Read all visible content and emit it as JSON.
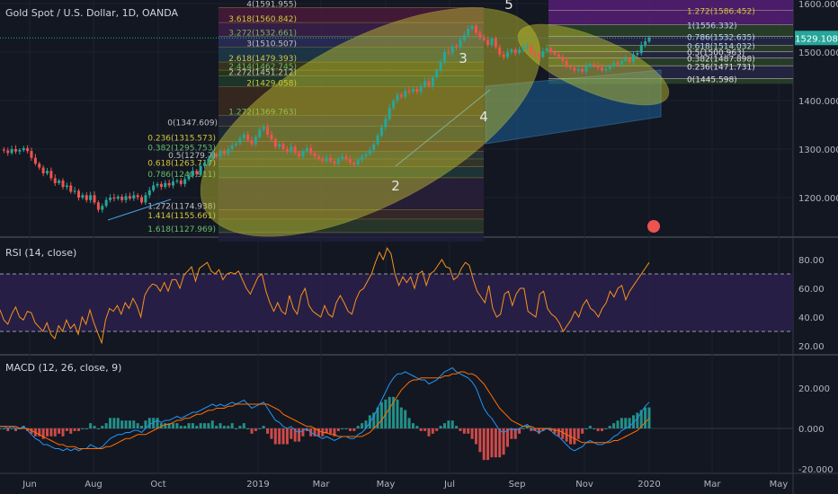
{
  "title": "Gold Spot / U.S. Dollar, 1D, OANDA",
  "price_badge": "1529.108",
  "colors": {
    "background": "#131722",
    "grid": "#363a45",
    "text": "#b2b5be",
    "price_line": "#26a69a",
    "candle_up": "#26a69a",
    "candle_down": "#ef5350",
    "rsi_line": "#f7931a",
    "rsi_band": "#2a1f4a",
    "macd_line": "#2196f3",
    "signal_line": "#ff6d00",
    "hist_up": "#26a69a",
    "hist_down": "#ef5350",
    "ellipse": "#c8c830",
    "channel": "#1e6fb3"
  },
  "chart_data": [
    {
      "type": "candlestick",
      "title": "Gold Spot / U.S. Dollar, 1D, OANDA",
      "ylim": [
        1120,
        1615
      ],
      "y_ticks": [
        "1600.000",
        "1500.000",
        "1400.000",
        "1300.000",
        "1200.000"
      ],
      "x_ticks": [
        "Jun",
        "Aug",
        "Oct",
        "2019",
        "Mar",
        "May",
        "Jul",
        "Sep",
        "Nov",
        "2020",
        "Mar",
        "May"
      ],
      "close_path": [
        1299,
        1297,
        1292,
        1300,
        1295,
        1298,
        1302,
        1296,
        1282,
        1270,
        1262,
        1250,
        1255,
        1240,
        1230,
        1235,
        1222,
        1225,
        1212,
        1214,
        1200,
        1205,
        1195,
        1205,
        1190,
        1175,
        1183,
        1195,
        1200,
        1198,
        1202,
        1195,
        1203,
        1198,
        1205,
        1201,
        1190,
        1205,
        1215,
        1225,
        1228,
        1222,
        1230,
        1225,
        1233,
        1235,
        1228,
        1238,
        1245,
        1255,
        1248,
        1265,
        1272,
        1280,
        1290,
        1285,
        1295,
        1290,
        1300,
        1308,
        1312,
        1322,
        1330,
        1318,
        1310,
        1325,
        1340,
        1346,
        1330,
        1320,
        1305,
        1310,
        1300,
        1295,
        1305,
        1292,
        1285,
        1295,
        1302,
        1292,
        1285,
        1280,
        1275,
        1282,
        1275,
        1270,
        1280,
        1285,
        1280,
        1272,
        1268,
        1278,
        1285,
        1290,
        1298,
        1310,
        1328,
        1345,
        1362,
        1385,
        1400,
        1412,
        1408,
        1420,
        1418,
        1424,
        1418,
        1430,
        1440,
        1430,
        1448,
        1462,
        1480,
        1500,
        1498,
        1512,
        1510,
        1525,
        1535,
        1548,
        1554,
        1540,
        1530,
        1525,
        1515,
        1528,
        1510,
        1495,
        1490,
        1500,
        1505,
        1498,
        1505,
        1510,
        1512,
        1498,
        1495,
        1490,
        1502,
        1508,
        1500,
        1495,
        1490,
        1482,
        1470,
        1468,
        1462,
        1465,
        1460,
        1470,
        1475,
        1472,
        1468,
        1462,
        1465,
        1470,
        1478,
        1475,
        1482,
        1486,
        1480,
        1495,
        1498,
        1515,
        1522,
        1530
      ],
      "fibonacci_levels": [
        {
          "label": "4(1591.955)",
          "value": 1591.955
        },
        {
          "label": "3.618(1560.842)",
          "value": 1560.842
        },
        {
          "label": "3.272(1532.661)",
          "value": 1532.661
        },
        {
          "label": "3(1510.507)",
          "value": 1510.507
        },
        {
          "label": "2.618(1479.393)",
          "value": 1479.393
        },
        {
          "label": "2.414(1462.745)",
          "value": 1462.745
        },
        {
          "label": "2.272(1451.212)",
          "value": 1451.212
        },
        {
          "label": "2(1429.058)",
          "value": 1429.058
        },
        {
          "label": "1.272(1369.763)",
          "value": 1369.763
        },
        {
          "label": "0(1347.609)",
          "value": 1347.609
        },
        {
          "label": "0.236(1315.573)",
          "value": 1315.573
        },
        {
          "label": "0.382(1295.753)",
          "value": 1295.753
        },
        {
          "label": "0.5(1279.7)",
          "value": 1279.7
        },
        {
          "label": "0.618(1263.717)",
          "value": 1263.717
        },
        {
          "label": "0.786(1240.911)",
          "value": 1240.911
        },
        {
          "label": "1.272(1174.938)",
          "value": 1174.938
        },
        {
          "label": "1.414(1155.661)",
          "value": 1155.661
        },
        {
          "label": "1.618(1127.969)",
          "value": 1127.969
        }
      ],
      "fibonacci_right": [
        {
          "label": "1.272(1586.452)",
          "value": 1586.452
        },
        {
          "label": "1(1556.332)",
          "value": 1556.332
        },
        {
          "label": "0.786(1532.635)",
          "value": 1532.635
        },
        {
          "label": "0.618(1514.032)",
          "value": 1514.032
        },
        {
          "label": "0.5(1500.963)",
          "value": 1500.963
        },
        {
          "label": "0.382(1487.898)",
          "value": 1487.898
        },
        {
          "label": "0.236(1471.731)",
          "value": 1471.731
        },
        {
          "label": "0(1445.598)",
          "value": 1445.598
        }
      ],
      "wave_labels": [
        "2",
        "3",
        "4",
        "5"
      ],
      "last_price": 1529.108
    },
    {
      "type": "line",
      "title": "RSI (14, close)",
      "ylim": [
        15,
        92
      ],
      "levels": [
        70,
        30
      ],
      "y_ticks": [
        "80.00",
        "60.00",
        "40.00",
        "20.00"
      ],
      "values": [
        45,
        38,
        35,
        42,
        47,
        40,
        38,
        44,
        43,
        36,
        33,
        30,
        36,
        28,
        25,
        34,
        30,
        38,
        32,
        35,
        28,
        40,
        35,
        45,
        36,
        29,
        22,
        38,
        46,
        44,
        48,
        42,
        50,
        46,
        53,
        48,
        40,
        55,
        60,
        63,
        62,
        58,
        64,
        58,
        66,
        66,
        60,
        69,
        72,
        75,
        65,
        74,
        76,
        78,
        72,
        70,
        73,
        66,
        70,
        71,
        70,
        72,
        66,
        60,
        56,
        62,
        68,
        70,
        58,
        50,
        44,
        50,
        44,
        42,
        55,
        46,
        42,
        55,
        60,
        48,
        44,
        42,
        40,
        48,
        42,
        40,
        50,
        55,
        50,
        44,
        42,
        52,
        58,
        60,
        65,
        70,
        78,
        85,
        80,
        88,
        84,
        70,
        62,
        68,
        64,
        68,
        60,
        70,
        72,
        62,
        70,
        72,
        76,
        80,
        75,
        74,
        66,
        68,
        74,
        78,
        76,
        66,
        58,
        54,
        50,
        62,
        46,
        40,
        42,
        56,
        58,
        48,
        56,
        60,
        60,
        44,
        42,
        40,
        56,
        58,
        46,
        42,
        40,
        36,
        30,
        34,
        38,
        44,
        40,
        48,
        52,
        46,
        44,
        40,
        46,
        50,
        58,
        54,
        60,
        62,
        52,
        58,
        62,
        66,
        70,
        74,
        78
      ]
    },
    {
      "type": "line+bar",
      "title": "MACD (12, 26, close, 9)",
      "ylim": [
        -21,
        35
      ],
      "y_ticks": [
        "20.000",
        "0.000",
        "-20.000"
      ],
      "macd": [
        1,
        1,
        0,
        1,
        0,
        0,
        1,
        -1,
        -3,
        -5,
        -6,
        -8,
        -8,
        -9,
        -10,
        -10,
        -11,
        -10,
        -11,
        -10,
        -11,
        -10,
        -10,
        -8,
        -9,
        -10,
        -9,
        -7,
        -5,
        -4,
        -3,
        -3,
        -2,
        -2,
        -1,
        -1,
        -2,
        0,
        2,
        3,
        4,
        3,
        4,
        4,
        5,
        6,
        5,
        6,
        7,
        8,
        8,
        9,
        10,
        11,
        12,
        11,
        12,
        11,
        12,
        13,
        12,
        13,
        14,
        12,
        10,
        11,
        12,
        13,
        10,
        7,
        4,
        3,
        1,
        0,
        1,
        -1,
        -2,
        -1,
        0,
        -2,
        -3,
        -4,
        -5,
        -4,
        -5,
        -6,
        -5,
        -4,
        -4,
        -5,
        -5,
        -3,
        -2,
        0,
        3,
        6,
        10,
        14,
        18,
        22,
        25,
        27,
        27,
        28,
        27,
        26,
        25,
        24,
        24,
        22,
        23,
        24,
        26,
        28,
        29,
        30,
        28,
        27,
        26,
        25,
        23,
        20,
        15,
        10,
        7,
        5,
        2,
        -1,
        -2,
        -1,
        0,
        -1,
        0,
        1,
        2,
        0,
        -1,
        -2,
        -1,
        0,
        -1,
        -3,
        -4,
        -6,
        -8,
        -10,
        -11,
        -10,
        -9,
        -7,
        -6,
        -7,
        -8,
        -8,
        -7,
        -6,
        -4,
        -3,
        -1,
        0,
        1,
        3,
        5,
        8,
        11,
        13
      ],
      "signal": [
        1,
        1,
        1,
        1,
        1,
        0,
        0,
        0,
        -1,
        -2,
        -3,
        -4,
        -5,
        -6,
        -7,
        -8,
        -8,
        -9,
        -9,
        -9,
        -10,
        -10,
        -10,
        -10,
        -10,
        -10,
        -10,
        -9,
        -9,
        -8,
        -7,
        -6,
        -5,
        -5,
        -4,
        -3,
        -3,
        -3,
        -2,
        -1,
        0,
        1,
        2,
        2,
        3,
        4,
        4,
        5,
        5,
        6,
        7,
        7,
        8,
        9,
        9,
        10,
        10,
        10,
        11,
        11,
        12,
        12,
        12,
        12,
        12,
        12,
        12,
        12,
        12,
        11,
        10,
        9,
        7,
        6,
        5,
        4,
        3,
        2,
        1,
        1,
        0,
        -1,
        -2,
        -2,
        -3,
        -3,
        -4,
        -4,
        -4,
        -4,
        -4,
        -4,
        -4,
        -3,
        -2,
        0,
        2,
        4,
        7,
        10,
        13,
        16,
        19,
        21,
        23,
        24,
        24,
        25,
        25,
        25,
        25,
        25,
        25,
        26,
        26,
        27,
        27,
        28,
        28,
        27,
        27,
        26,
        24,
        22,
        19,
        16,
        13,
        10,
        8,
        6,
        4,
        3,
        2,
        1,
        1,
        1,
        0,
        0,
        0,
        0,
        0,
        -1,
        -1,
        -2,
        -3,
        -4,
        -5,
        -6,
        -7,
        -7,
        -7,
        -7,
        -7,
        -7,
        -7,
        -7,
        -6,
        -6,
        -5,
        -4,
        -3,
        -2,
        -1,
        1,
        3,
        5
      ]
    }
  ]
}
